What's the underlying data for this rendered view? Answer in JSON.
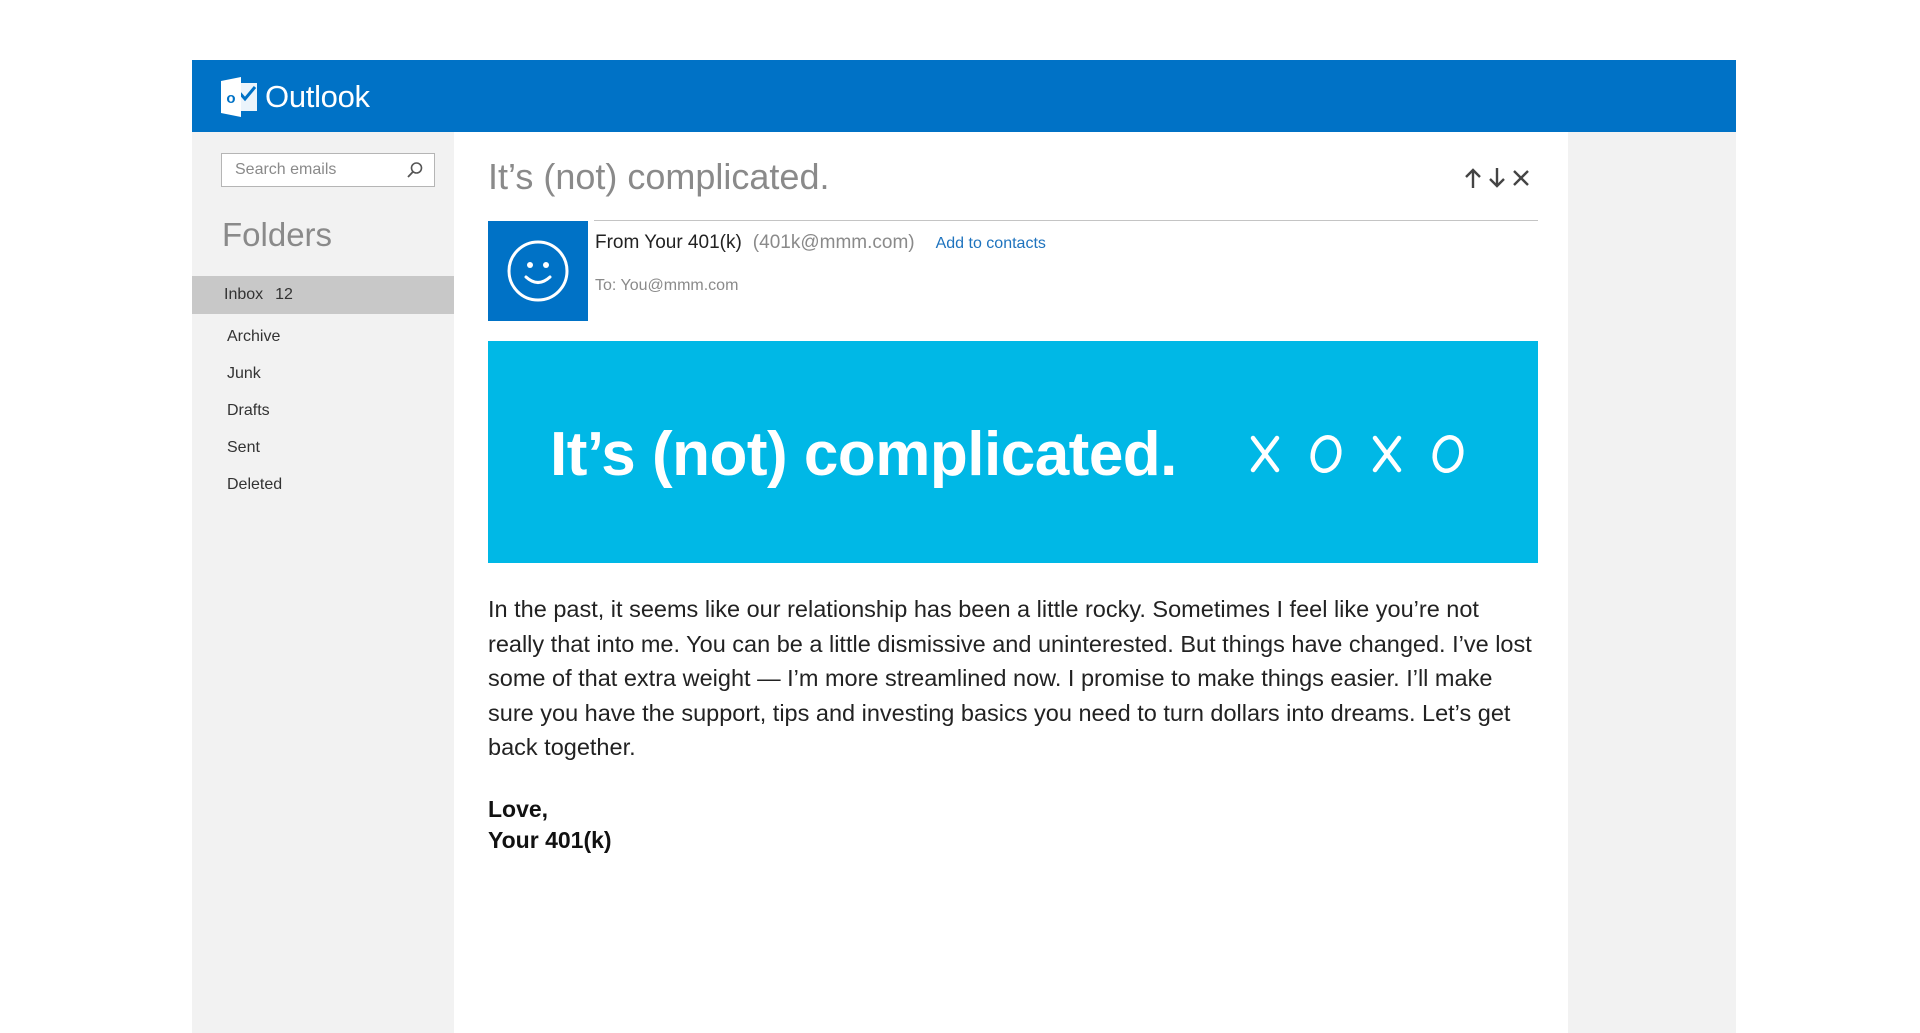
{
  "app": {
    "name": "Outlook",
    "brand_color": "#0072c6",
    "logo_letter": "o"
  },
  "search": {
    "placeholder": "Search emails",
    "icon": "search-icon"
  },
  "sidebar": {
    "heading": "Folders",
    "inbox": {
      "label": "Inbox",
      "count": "12"
    },
    "folders": [
      {
        "label": "Archive"
      },
      {
        "label": "Junk"
      },
      {
        "label": "Drafts"
      },
      {
        "label": "Sent"
      },
      {
        "label": "Deleted"
      }
    ]
  },
  "message": {
    "subject": "It’s (not) complicated.",
    "actions": [
      "arrow-up-icon",
      "arrow-down-icon",
      "close-icon"
    ],
    "sender_name": "From Your 401(k)",
    "sender_email": "(401k@mmm.com)",
    "add_contacts": "Add to contacts",
    "to": "To: You@mmm.com",
    "avatar_icon": "smiley-icon",
    "banner": {
      "headline": "It’s (not) complicated.",
      "xoxo": [
        "X",
        "O",
        "X",
        "O"
      ],
      "color": "#00b8e6"
    },
    "body": "In the past, it seems like our relationship has been a little rocky. Sometimes I feel like you’re not really that into me. You can be a little dismissive and uninterested. But things have changed. I’ve lost some of that extra weight — I’m more streamlined now. I promise to make things easier. I’ll make sure you have the support, tips and investing basics you need to turn dollars into dreams. Let’s get back together.",
    "signoff_1": "Love,",
    "signoff_2": "Your 401(k)"
  }
}
